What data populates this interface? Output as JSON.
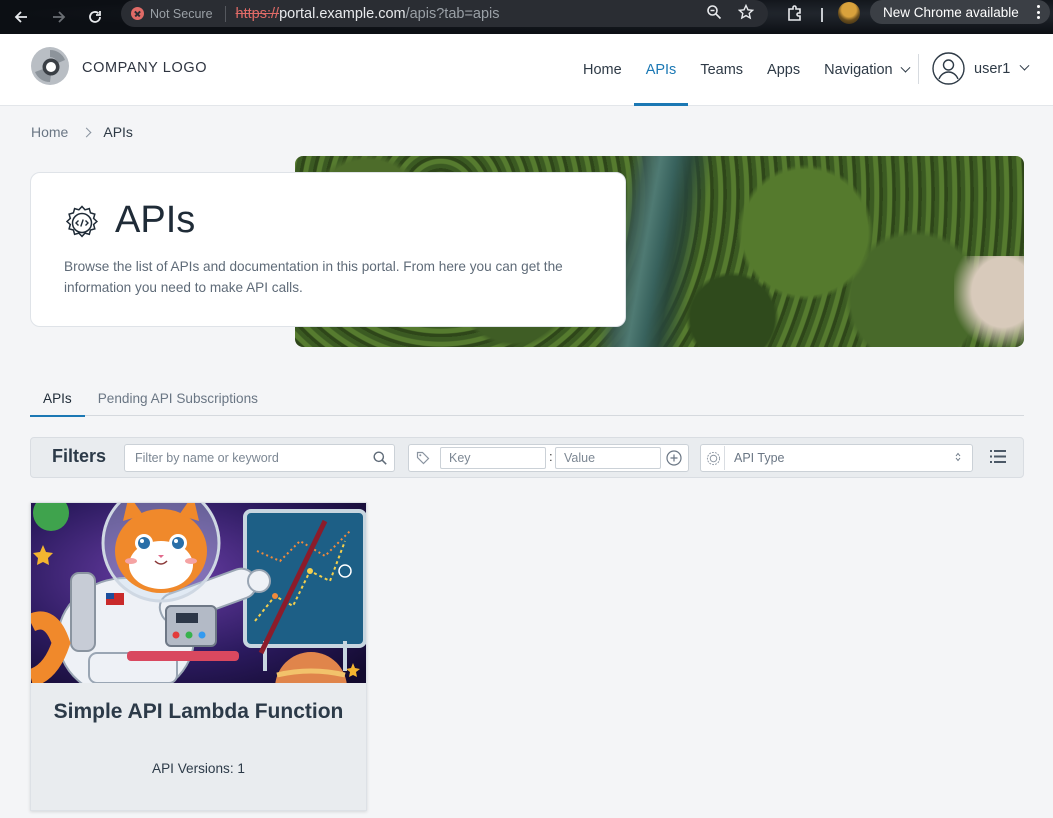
{
  "browser": {
    "security_label": "Not Secure",
    "url_scheme": "https://",
    "url_host": "portal.example.com",
    "url_path": "/apis?tab=apis",
    "update_label": "New Chrome available"
  },
  "header": {
    "logo_text": "COMPANY LOGO",
    "nav": [
      {
        "label": "Home",
        "active": false
      },
      {
        "label": "APIs",
        "active": true
      },
      {
        "label": "Teams",
        "active": false
      },
      {
        "label": "Apps",
        "active": false
      },
      {
        "label": "Navigation",
        "active": false,
        "dropdown": true
      }
    ],
    "user_name": "user1"
  },
  "breadcrumb": {
    "home": "Home",
    "current": "APIs"
  },
  "hero": {
    "title": "APIs",
    "description": "Browse the list of APIs and documentation in this portal. From here you can get the information you need to make API calls."
  },
  "tabs": [
    {
      "label": "APIs",
      "active": true
    },
    {
      "label": "Pending API Subscriptions",
      "active": false
    }
  ],
  "filters": {
    "label": "Filters",
    "search_placeholder": "Filter by name or keyword",
    "key_placeholder": "Key",
    "value_placeholder": "Value",
    "api_type_label": "API Type"
  },
  "apis": [
    {
      "name": "Simple API Lambda Function",
      "versions_label": "API Versions: 1"
    }
  ],
  "colors": {
    "accent": "#1b78b4",
    "text": "#25313d",
    "page_bg": "#f4f5f7"
  }
}
